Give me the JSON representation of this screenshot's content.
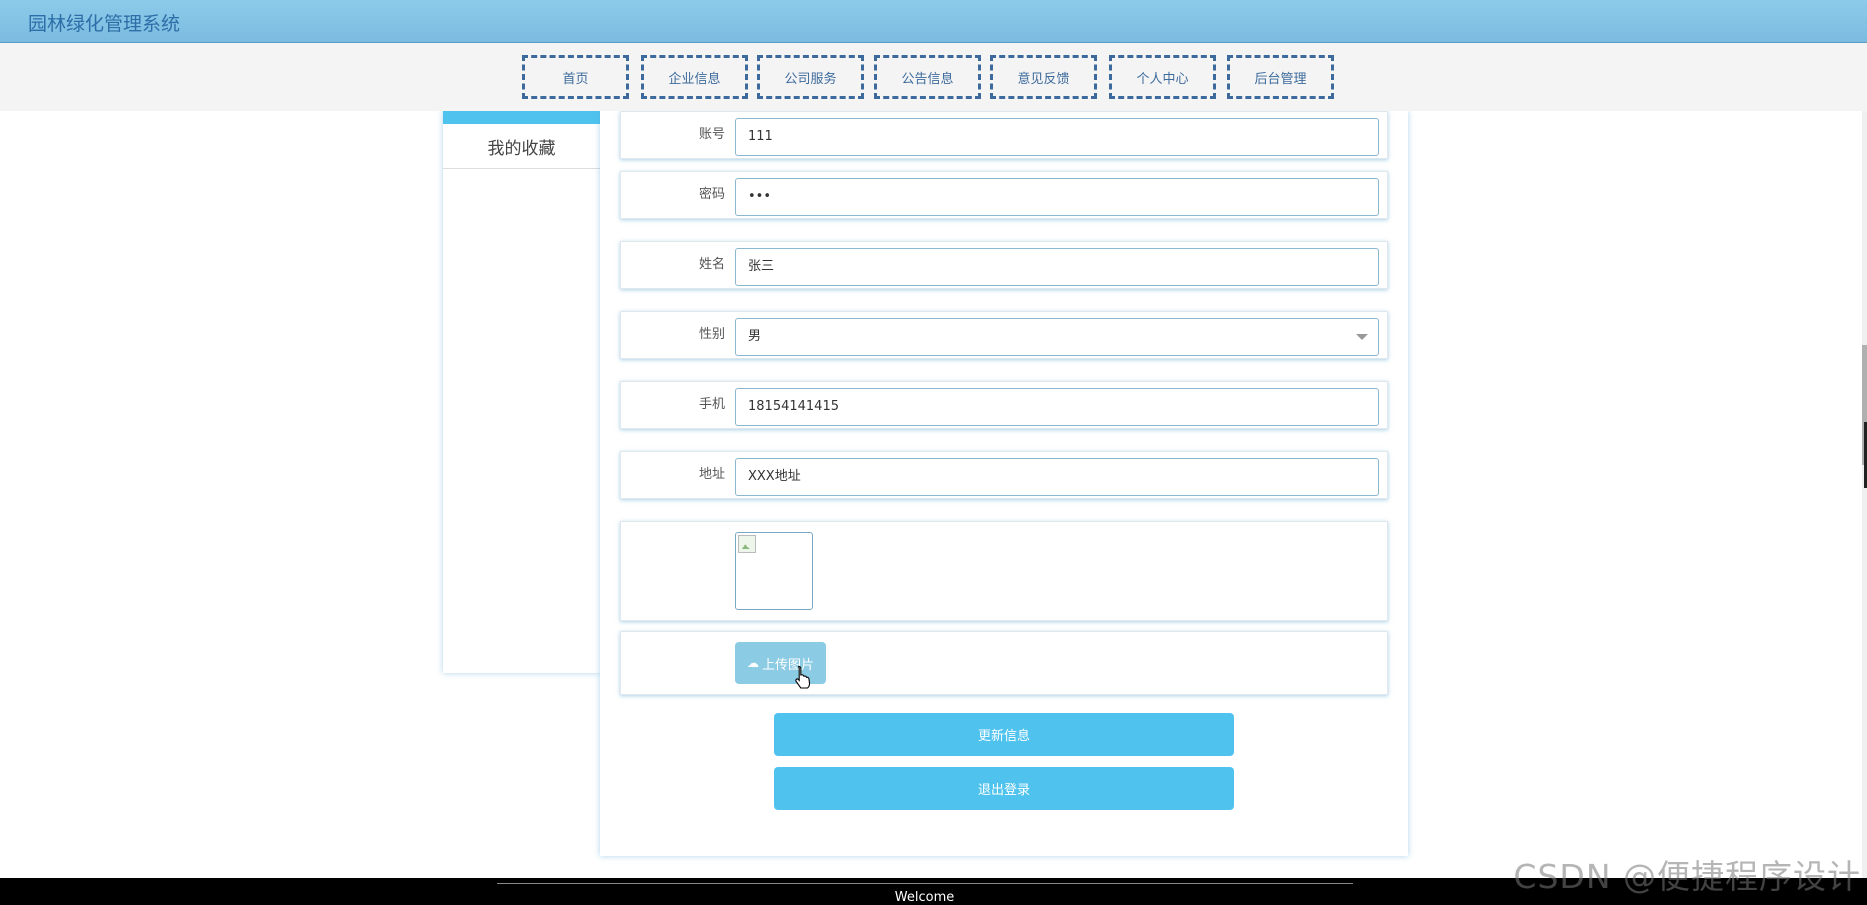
{
  "header": {
    "title": "园林绿化管理系统"
  },
  "nav": {
    "items": [
      "首页",
      "企业信息",
      "公司服务",
      "公告信息",
      "意见反馈",
      "个人中心",
      "后台管理"
    ]
  },
  "sidebar": {
    "items": [
      {
        "label": "我的收藏"
      }
    ]
  },
  "form": {
    "account_label": "账号",
    "account_value": "111",
    "password_label": "密码",
    "password_value": "•••",
    "name_label": "姓名",
    "name_value": "张三",
    "gender_label": "性别",
    "gender_value": "男",
    "phone_label": "手机",
    "phone_value": "18154141415",
    "address_label": "地址",
    "address_value": "XXX地址",
    "upload_label": "上传图片",
    "update_label": "更新信息",
    "logout_label": "退出登录"
  },
  "footer": {
    "text": "Welcome"
  },
  "watermark": "CSDN @便捷程序设计",
  "colors": {
    "accent": "#4fc3ee",
    "nav_border": "#3d6a9c",
    "header": "#8ccbe9"
  },
  "icons": {
    "upload": "cloud-upload-icon",
    "select": "caret-down-icon"
  }
}
